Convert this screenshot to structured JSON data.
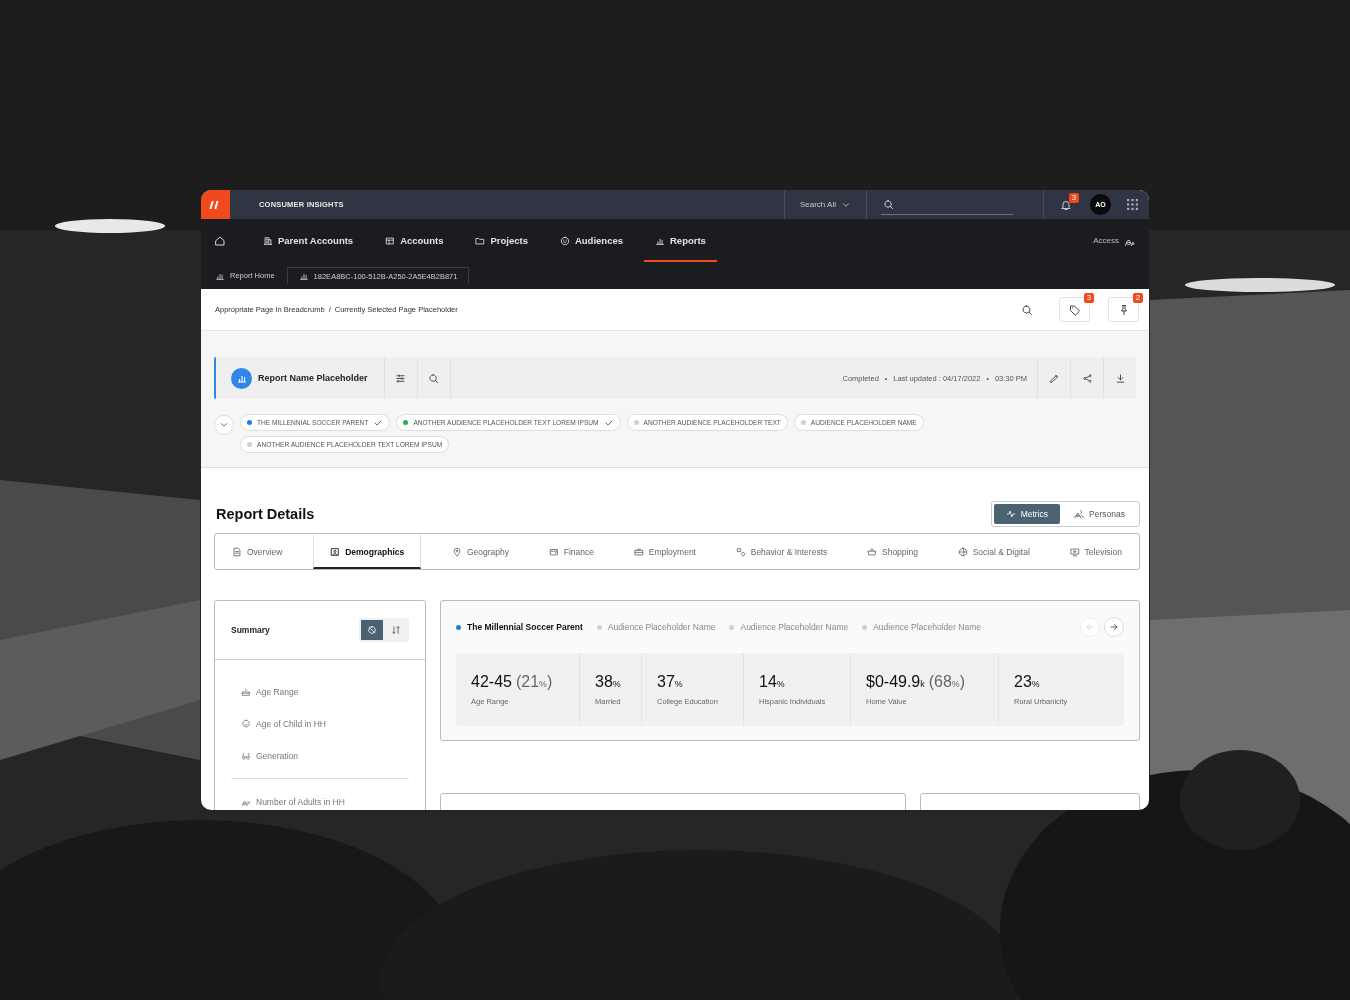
{
  "header": {
    "app_name": "CONSUMER INSIGHTS",
    "search_scope": "Search All",
    "notifications": "3",
    "user_initials": "AO"
  },
  "nav": {
    "items": [
      {
        "label": "Parent Accounts",
        "selected": false
      },
      {
        "label": "Accounts",
        "selected": false
      },
      {
        "label": "Projects",
        "selected": false
      },
      {
        "label": "Audiences",
        "selected": false
      },
      {
        "label": "Reports",
        "selected": true
      }
    ],
    "access": "Access"
  },
  "subnav": {
    "home": "Report Home",
    "report_id": "182EA8BC-100-512B-A250-2A5E4B2B871"
  },
  "breadcrumb": {
    "items": [
      "Appropriate Page In Breadcrumb",
      "Currently Selected Page Placeholder"
    ],
    "separator": "/",
    "tags_count": "3",
    "pins_count": "2"
  },
  "report": {
    "name": "Report Name Placeholder",
    "status": "Completed",
    "last_updated": "Last updated : 04/17/2022",
    "time": "03:30 PM",
    "separator": "•"
  },
  "audience_chips": [
    {
      "label": "THE MILLENNIAL SOCCER PARENT",
      "color": "#1f7fe0",
      "checked": true
    },
    {
      "label": "ANOTHER AUDIENCE PLACEHOLDER TEXT LOREM IPSUM",
      "color": "#22b04a",
      "checked": true
    },
    {
      "label": "ANOTHER AUDIENCE PLACEHOLDER TEXT",
      "color": "#d0d0d0",
      "checked": false
    },
    {
      "label": "AUDIENCE PLACEHOLDER NAME",
      "color": "#d0d0d0",
      "checked": false
    },
    {
      "label": "ANOTHER AUDIENCE PLACEHOLDER TEXT LOREM IPSUM",
      "color": "#d0d0d0",
      "checked": false
    }
  ],
  "details": {
    "title": "Report Details",
    "views": [
      {
        "label": "Metrics",
        "selected": true
      },
      {
        "label": "Personas",
        "selected": false
      }
    ],
    "tabs": [
      {
        "label": "Overview",
        "selected": false
      },
      {
        "label": "Demographics",
        "selected": true
      },
      {
        "label": "Geography",
        "selected": false
      },
      {
        "label": "Finance",
        "selected": false
      },
      {
        "label": "Employment",
        "selected": false
      },
      {
        "label": "Behavior & Interests",
        "selected": false
      },
      {
        "label": "Shopping",
        "selected": false
      },
      {
        "label": "Social & Digital",
        "selected": false
      },
      {
        "label": "Television",
        "selected": false
      }
    ]
  },
  "summary": {
    "title": "Summary",
    "modes": [
      {
        "selected": true
      },
      {
        "selected": false
      }
    ],
    "groups": [
      {
        "items": [
          "Age Range",
          "Age of Child in HH",
          "Generation"
        ]
      },
      {
        "items": [
          "Number of Adults in HH"
        ]
      }
    ]
  },
  "audiences": [
    {
      "label": "The Millennial Soccer Parent",
      "selected": true
    },
    {
      "label": "Audience Placeholder Name",
      "selected": false
    },
    {
      "label": "Audience Placeholder Name",
      "selected": false
    },
    {
      "label": "Audience Placeholder Name",
      "selected": false
    }
  ],
  "pager": {
    "prev_disabled": true
  },
  "metrics": [
    {
      "value": "42-45",
      "share": "(21$_{%}$)",
      "label": "Age Range"
    },
    {
      "value": "38$_{%}$",
      "label": "Married"
    },
    {
      "value": "37$_{%}$",
      "label": "College Education"
    },
    {
      "value": "14$_{%}$",
      "label": "Hispanic Individuals"
    },
    {
      "value": "$0-49.9$_{k}$",
      "share": "(68$_{%}$)",
      "label": "Home Value"
    },
    {
      "value": "23$_{%}$",
      "label": "Rural Urbanicity"
    }
  ]
}
